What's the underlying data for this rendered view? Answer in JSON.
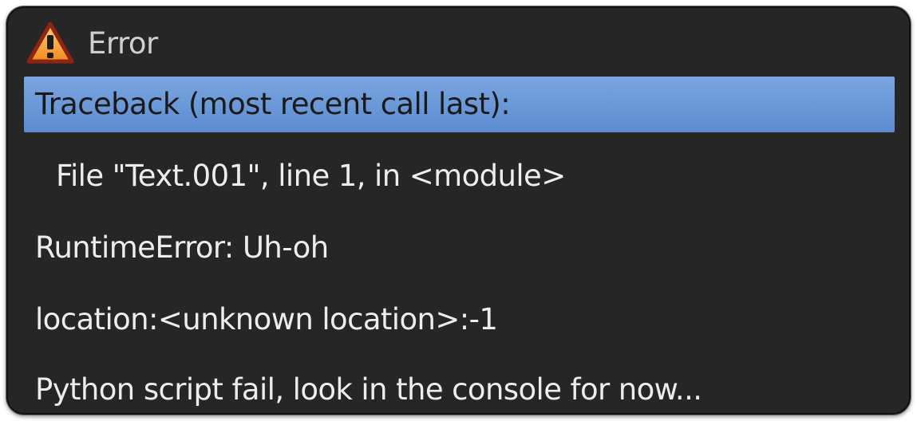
{
  "dialog": {
    "title": "Error",
    "icon": "warning-icon",
    "lines": [
      "Traceback (most recent call last):",
      "File \"Text.001\", line 1, in <module>",
      "RuntimeError: Uh-oh",
      "location:<unknown location>:-1",
      "Python script fail, look in the console for now..."
    ]
  },
  "colors": {
    "background": "#262626",
    "highlight": "#6b98d8",
    "text": "#ececec",
    "warning_fill": "#f5a623",
    "warning_outline": "#9e2a10"
  }
}
